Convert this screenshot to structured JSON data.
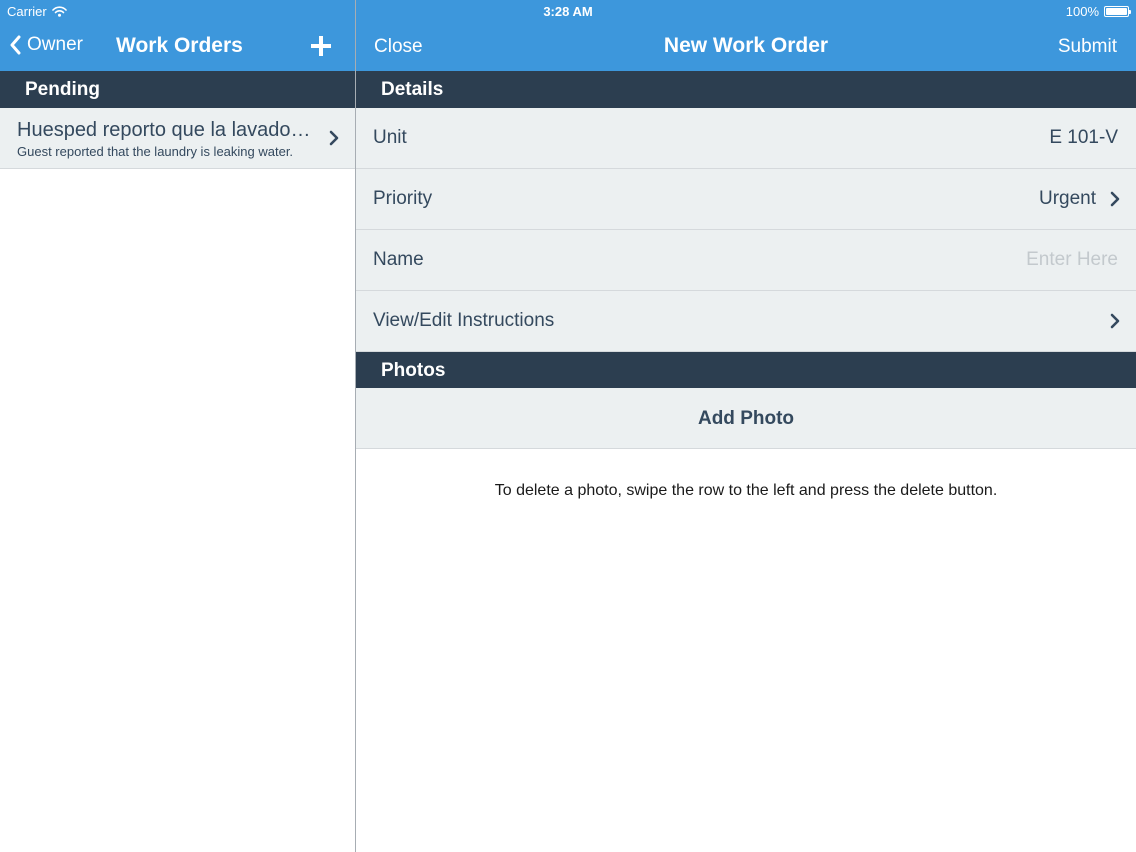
{
  "status": {
    "carrier": "Carrier",
    "time": "3:28 AM",
    "battery": "100%"
  },
  "left": {
    "back_label": "Owner",
    "title": "Work Orders",
    "section": "Pending",
    "work_orders": [
      {
        "title": "Huesped reporto que la lavadora esta perdiendo agua.",
        "subtitle": "Guest reported that the laundry is leaking water."
      }
    ]
  },
  "right": {
    "close_label": "Close",
    "title": "New Work Order",
    "submit_label": "Submit",
    "details_section": "Details",
    "unit": {
      "label": "Unit",
      "value": "E 101-V"
    },
    "priority": {
      "label": "Priority",
      "value": "Urgent"
    },
    "name": {
      "label": "Name",
      "value": "",
      "placeholder": "Enter Here"
    },
    "instructions": {
      "label": "View/Edit Instructions"
    },
    "photos_section": "Photos",
    "add_photo_label": "Add Photo",
    "hint": "To delete a photo, swipe the row to the left and press the delete button."
  },
  "colors": {
    "nav": "#3d97dc",
    "section": "#2c3e50",
    "row": "#ecf0f1",
    "text": "#34495e"
  }
}
